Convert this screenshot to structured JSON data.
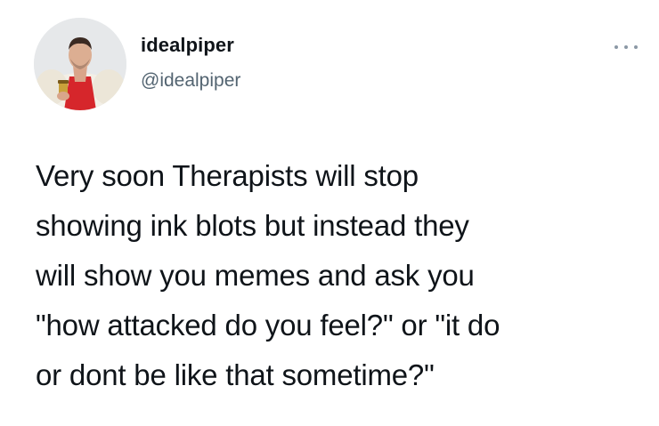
{
  "author": {
    "display_name": "idealpiper",
    "handle": "@idealpiper",
    "avatar_icon": "user-avatar-photo"
  },
  "more_icon": "more-horizontal-icon",
  "tweet": {
    "text": "Very soon Therapists will stop\nshowing ink blots but instead they\nwill show you memes and ask you\n\"how attacked do you feel?\" or \"it do\nor dont be like that sometime?\""
  },
  "colors": {
    "text": "#0f1419",
    "secondary_text": "#536471",
    "background": "#ffffff"
  }
}
